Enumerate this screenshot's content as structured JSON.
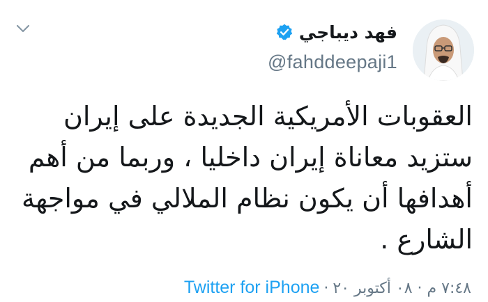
{
  "user": {
    "display_name": "فهد ديباجي",
    "handle": "@fahddeepaji1",
    "verified": true
  },
  "tweet": {
    "lines": [
      "العقوبات الأمريكية الجديدة على إيران",
      "ستزيد معاناة إيران داخليا ، وربما من أهم",
      "أهدافها أن يكون نظام الملالي في مواجهة",
      "الشارع ."
    ]
  },
  "meta": {
    "time_date": "٧:٤٨ م · ٠٨ أكتوبر ٢٠",
    "separator": "·",
    "source": "Twitter for iPhone"
  },
  "icons": {
    "verified": "verified-badge-icon",
    "chevron": "chevron-down-icon"
  },
  "colors": {
    "verified": "#1da1f2",
    "link": "#1da1f2",
    "secondary_text": "#657786",
    "primary_text": "#14171a"
  }
}
